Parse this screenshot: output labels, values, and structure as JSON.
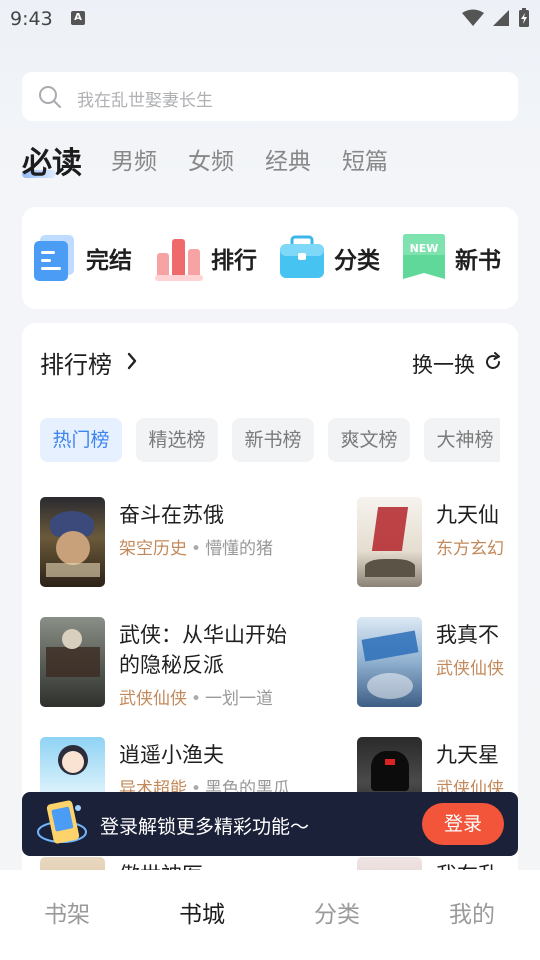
{
  "status": {
    "time": "9:43",
    "a_icon": "A"
  },
  "search": {
    "placeholder": "我在乱世娶妻长生"
  },
  "tabs": [
    {
      "label": "必读",
      "active": true
    },
    {
      "label": "男频"
    },
    {
      "label": "女频"
    },
    {
      "label": "经典"
    },
    {
      "label": "短篇"
    }
  ],
  "quick": [
    {
      "label": "完结",
      "icon": "finished-icon"
    },
    {
      "label": "排行",
      "icon": "ranking-icon"
    },
    {
      "label": "分类",
      "icon": "category-icon"
    },
    {
      "label": "新书",
      "icon": "new-book-icon",
      "badge": "NEW"
    }
  ],
  "ranking": {
    "title": "排行榜",
    "swap_label": "换一换",
    "chips": [
      "热门榜",
      "精选榜",
      "新书榜",
      "爽文榜",
      "大神榜"
    ],
    "books": [
      {
        "title": "奋斗在苏俄",
        "genre": "架空历史",
        "author": "懵懂的猪"
      },
      {
        "title": "九天仙",
        "genre": "东方玄幻",
        "author": ""
      },
      {
        "title": "武侠：从华山开始",
        "title2": "的隐秘反派",
        "genre": "武侠仙侠",
        "author": "一划一道"
      },
      {
        "title": "我真不",
        "genre": "武侠仙侠",
        "author": ""
      },
      {
        "title": "逍遥小渔夫",
        "genre": "异术超能",
        "author": "黑色的黑瓜"
      },
      {
        "title": "九天星",
        "genre": "武侠仙侠",
        "author": ""
      },
      {
        "title": "傲世神医",
        "genre": "",
        "author": ""
      },
      {
        "title": "我在乱",
        "genre": "",
        "author": ""
      }
    ]
  },
  "banner": {
    "text": "登录解锁更多精彩功能～",
    "button": "登录"
  },
  "bottom_nav": [
    "书架",
    "书城",
    "分类",
    "我的"
  ],
  "colors": {
    "accent": "#3d86f0",
    "genre": "#c3895a",
    "login": "#f2553a",
    "banner_bg": "#1b2138"
  }
}
